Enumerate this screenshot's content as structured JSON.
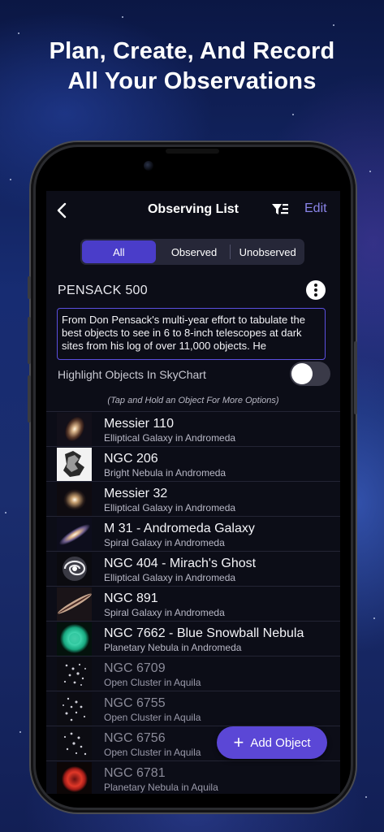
{
  "headline": {
    "line1": "Plan, Create, And Record",
    "line2": "All Your Observations"
  },
  "nav": {
    "title": "Observing List",
    "edit_label": "Edit",
    "back_icon": "chevron-left-icon",
    "filter_icon": "filter-icon"
  },
  "segments": [
    {
      "label": "All",
      "selected": true
    },
    {
      "label": "Observed",
      "selected": false
    },
    {
      "label": "Unobserved",
      "selected": false
    }
  ],
  "list": {
    "name": "PENSACK 500",
    "description": "From Don Pensack's multi-year effort to tabulate the best objects to see in 6 to 8-inch telescopes at dark sites from his log of over 11,000 objects. He",
    "highlight_label": "Highlight Objects In SkyChart",
    "highlight_on": false,
    "hint": "(Tap and Hold an Object For More Options)"
  },
  "objects": [
    {
      "name": "Messier 110",
      "type": "Elliptical Galaxy in Andromeda",
      "observed": true
    },
    {
      "name": "NGC 206",
      "type": "Bright Nebula in Andromeda",
      "observed": true
    },
    {
      "name": "Messier 32",
      "type": "Elliptical Galaxy in Andromeda",
      "observed": true
    },
    {
      "name": "M 31 - Andromeda Galaxy",
      "type": "Spiral Galaxy in Andromeda",
      "observed": true
    },
    {
      "name": "NGC 404 - Mirach's Ghost",
      "type": "Elliptical Galaxy in Andromeda",
      "observed": true
    },
    {
      "name": "NGC 891",
      "type": "Spiral Galaxy in Andromeda",
      "observed": true
    },
    {
      "name": "NGC 7662 - Blue Snowball Nebula",
      "type": "Planetary Nebula in Andromeda",
      "observed": true
    },
    {
      "name": "NGC 6709",
      "type": "Open Cluster in Aquila",
      "observed": false
    },
    {
      "name": "NGC 6755",
      "type": "Open Cluster in Aquila",
      "observed": false
    },
    {
      "name": "NGC 6756",
      "type": "Open Cluster in Aquila",
      "observed": false
    },
    {
      "name": "NGC 6781",
      "type": "Planetary Nebula in Aquila",
      "observed": false
    }
  ],
  "add_button": {
    "label": "Add Object",
    "icon": "plus-icon"
  },
  "colors": {
    "accent": "#5b47d6",
    "edit": "#8a84e8",
    "segment_active": "#4a3dc9"
  }
}
